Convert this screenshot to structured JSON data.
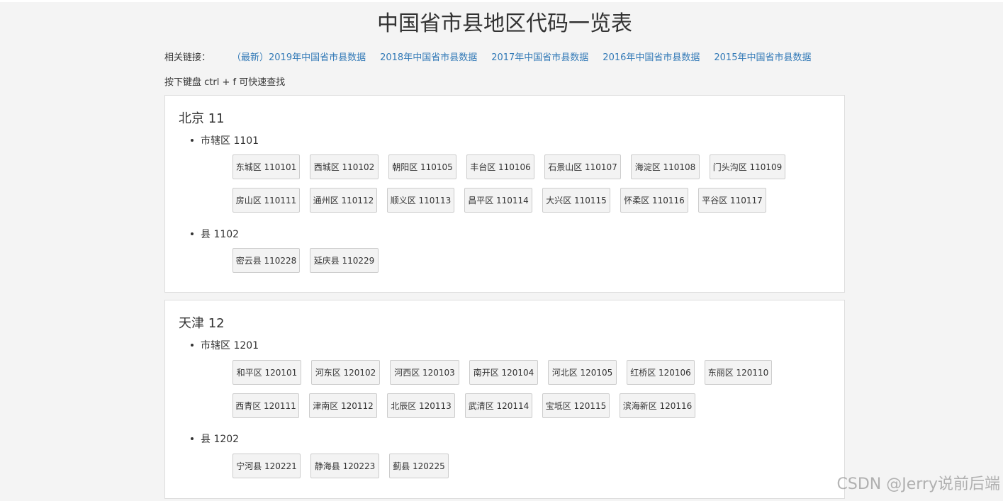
{
  "title": "中国省市县地区代码一览表",
  "links": {
    "label": "相关链接：",
    "items": [
      "（最新）2019年中国省市县数据",
      "2018年中国省市县数据",
      "2017年中国省市县数据",
      "2016年中国省市县数据",
      "2015年中国省市县数据"
    ]
  },
  "hint": "按下键盘 ctrl + f 可快速查找",
  "provinces": [
    {
      "name": "北京 11",
      "groups": [
        {
          "name": "市辖区 1101",
          "rows": [
            [
              "东城区 110101",
              "西城区 110102",
              "朝阳区 110105",
              "丰台区 110106",
              "石景山区 110107",
              "海淀区 110108",
              "门头沟区 110109"
            ],
            [
              "房山区 110111",
              "通州区 110112",
              "顺义区 110113",
              "昌平区 110114",
              "大兴区 110115",
              "怀柔区 110116",
              "平谷区 110117"
            ]
          ]
        },
        {
          "name": "县 1102",
          "rows": [
            [
              "密云县 110228",
              "延庆县 110229"
            ]
          ]
        }
      ]
    },
    {
      "name": "天津 12",
      "groups": [
        {
          "name": "市辖区 1201",
          "rows": [
            [
              "和平区 120101",
              "河东区 120102",
              "河西区 120103",
              "南开区 120104",
              "河北区 120105",
              "红桥区 120106",
              "东丽区 120110"
            ],
            [
              "西青区 120111",
              "津南区 120112",
              "北辰区 120113",
              "武清区 120114",
              "宝坻区 120115",
              "滨海新区 120116"
            ]
          ]
        },
        {
          "name": "县 1202",
          "rows": [
            [
              "宁河县 120221",
              "静海县 120223",
              "蓟县 120225"
            ]
          ]
        }
      ]
    }
  ],
  "watermark": "CSDN @Jerry说前后端"
}
